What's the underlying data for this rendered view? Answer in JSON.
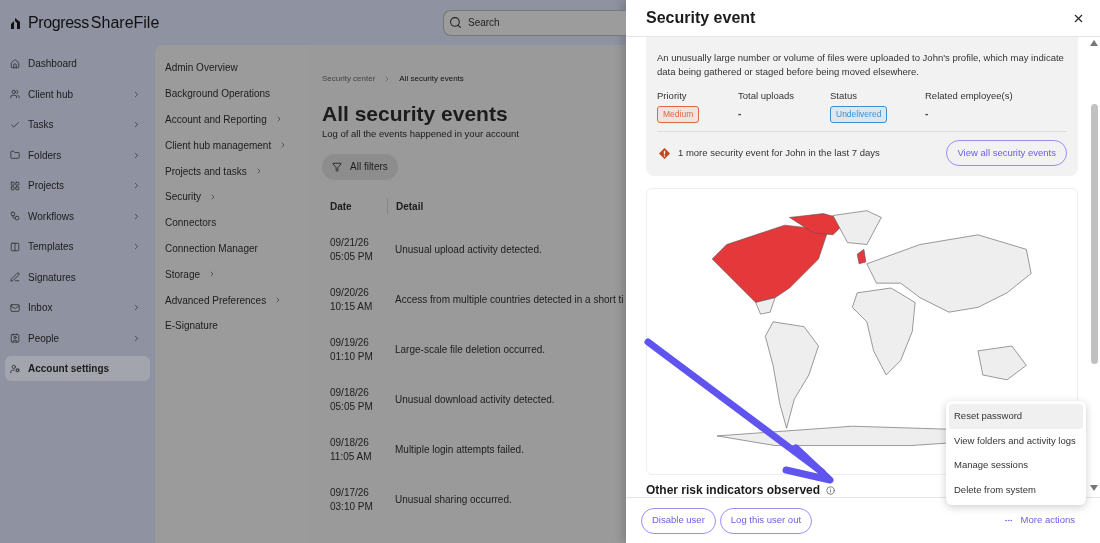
{
  "logo": {
    "brand": "Progress",
    "product": "ShareFile"
  },
  "search": {
    "placeholder": "Search"
  },
  "nav": [
    {
      "label": "Dashboard",
      "has_children": false,
      "selected": false
    },
    {
      "label": "Client hub",
      "has_children": true,
      "selected": false
    },
    {
      "label": "Tasks",
      "has_children": true,
      "selected": false
    },
    {
      "label": "Folders",
      "has_children": true,
      "selected": false
    },
    {
      "label": "Projects",
      "has_children": true,
      "selected": false
    },
    {
      "label": "Workflows",
      "has_children": true,
      "selected": false
    },
    {
      "label": "Templates",
      "has_children": true,
      "selected": false
    },
    {
      "label": "Signatures",
      "has_children": false,
      "selected": false
    },
    {
      "label": "Inbox",
      "has_children": true,
      "selected": false
    },
    {
      "label": "People",
      "has_children": true,
      "selected": false
    },
    {
      "label": "Account settings",
      "has_children": false,
      "selected": true
    }
  ],
  "submenu": [
    {
      "label": "Admin Overview",
      "has_children": false
    },
    {
      "label": "Background Operations",
      "has_children": false
    },
    {
      "label": "Account and Reporting",
      "has_children": true
    },
    {
      "label": "Client hub management",
      "has_children": true
    },
    {
      "label": "Projects and tasks",
      "has_children": true
    },
    {
      "label": "Security",
      "has_children": true
    },
    {
      "label": "Connectors",
      "has_children": false
    },
    {
      "label": "Connection Manager",
      "has_children": false
    },
    {
      "label": "Storage",
      "has_children": true
    },
    {
      "label": "Advanced Preferences",
      "has_children": true
    },
    {
      "label": "E-Signature",
      "has_children": false
    }
  ],
  "breadcrumbs": [
    "Security center",
    "All security events"
  ],
  "page": {
    "title": "All security events",
    "subtitle": "Log of all the events happened in your account",
    "filter_button": "All filters"
  },
  "table": {
    "columns": [
      "Date",
      "Detail"
    ],
    "rows": [
      {
        "date": "09/21/26",
        "time": "05:05 PM",
        "detail": "Unusual upload activity detected."
      },
      {
        "date": "09/20/26",
        "time": "10:15 AM",
        "detail": "Access from multiple countries detected in a short ti"
      },
      {
        "date": "09/19/26",
        "time": "01:10 PM",
        "detail": "Large-scale file deletion occurred."
      },
      {
        "date": "09/18/26",
        "time": "05:05 PM",
        "detail": "Unusual download activity detected."
      },
      {
        "date": "09/18/26",
        "time": "11:05 AM",
        "detail": "Multiple login attempts failed."
      },
      {
        "date": "09/17/26",
        "time": "03:10 PM",
        "detail": "Unusual sharing occurred."
      }
    ]
  },
  "panel": {
    "title": "Security event",
    "description": "An unusually large number or volume of files were uploaded to John's profile, which may indicate data being gathered or staged before being moved elsewhere.",
    "fields": [
      {
        "label": "Priority",
        "value": "Medium",
        "kind": "badge",
        "color": "#e0673f"
      },
      {
        "label": "Total uploads",
        "value": "-",
        "kind": "text"
      },
      {
        "label": "Status",
        "value": "Undelivered",
        "kind": "badge",
        "color": "#3b8ed0"
      },
      {
        "label": "Related employee(s)",
        "value": "-",
        "kind": "text"
      }
    ],
    "alert": "1 more security event for John in the last 7 days",
    "view_all_button": "View all security events",
    "section_heading": "Other risk indicators observed",
    "footer_buttons": [
      "Disable user",
      "Log this user out"
    ],
    "more_actions": "More actions",
    "menu": [
      {
        "label": "Reset password",
        "selected": true
      },
      {
        "label": "View folders and activity logs",
        "selected": false
      },
      {
        "label": "Manage sessions",
        "selected": false
      },
      {
        "label": "Delete from system",
        "selected": false
      }
    ]
  }
}
